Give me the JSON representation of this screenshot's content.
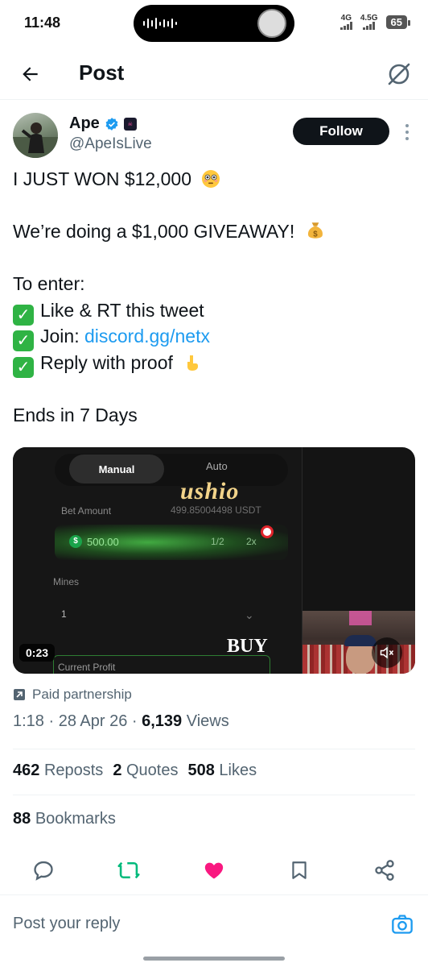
{
  "status_bar": {
    "time": "11:48",
    "network_1": "4G",
    "network_2": "4.5G",
    "battery": "65"
  },
  "header": {
    "title": "Post",
    "back_icon": "arrow-left-icon",
    "grok_icon": "grok-icon"
  },
  "author": {
    "name": "Ape",
    "handle": "@ApeIsLive",
    "verified_color": "#1d9bf0",
    "follow_label": "Follow"
  },
  "tweet": {
    "line1": "I JUST WON $12,000",
    "line2": "We’re doing a $1,000 GIVEAWAY!",
    "line3": "To enter:",
    "bullet1": "Like & RT this tweet",
    "bullet2_prefix": "Join: ",
    "bullet2_link": "discord.gg/netx",
    "bullet3": "Reply with proof",
    "line4": "Ends in 7 Days",
    "link_color": "#1d9bf0"
  },
  "media": {
    "tab_manual": "Manual",
    "tab_auto": "Auto",
    "bet_label": "Bet Amount",
    "bet_balance": "499.85004498 USDT",
    "bet_value": "500.00",
    "half": "1/2",
    "double": "2x",
    "mines_label": "Mines",
    "mines_value": "1",
    "profit_label": "Current Profit",
    "brand_overlay": "ushio",
    "buy_overlay": "BUY",
    "duration": "0:23"
  },
  "meta": {
    "paid_label": "Paid partnership",
    "timestamp": "1:18 · 28 Apr 26 · ",
    "views_count": "6,139",
    "views_label": " Views"
  },
  "stats": {
    "reposts_count": "462",
    "reposts_label": "Reposts",
    "quotes_count": "2",
    "quotes_label": "Quotes",
    "likes_count": "508",
    "likes_label": "Likes",
    "bookmarks_count": "88",
    "bookmarks_label": "Bookmarks"
  },
  "actions": {
    "reply_icon": "reply-icon",
    "repost_icon": "repost-icon",
    "like_icon": "heart-icon",
    "bookmark_icon": "bookmark-icon",
    "share_icon": "share-icon",
    "repost_color": "#00ba7c",
    "like_color": "#f91880"
  },
  "reply": {
    "placeholder": "Post your reply"
  }
}
